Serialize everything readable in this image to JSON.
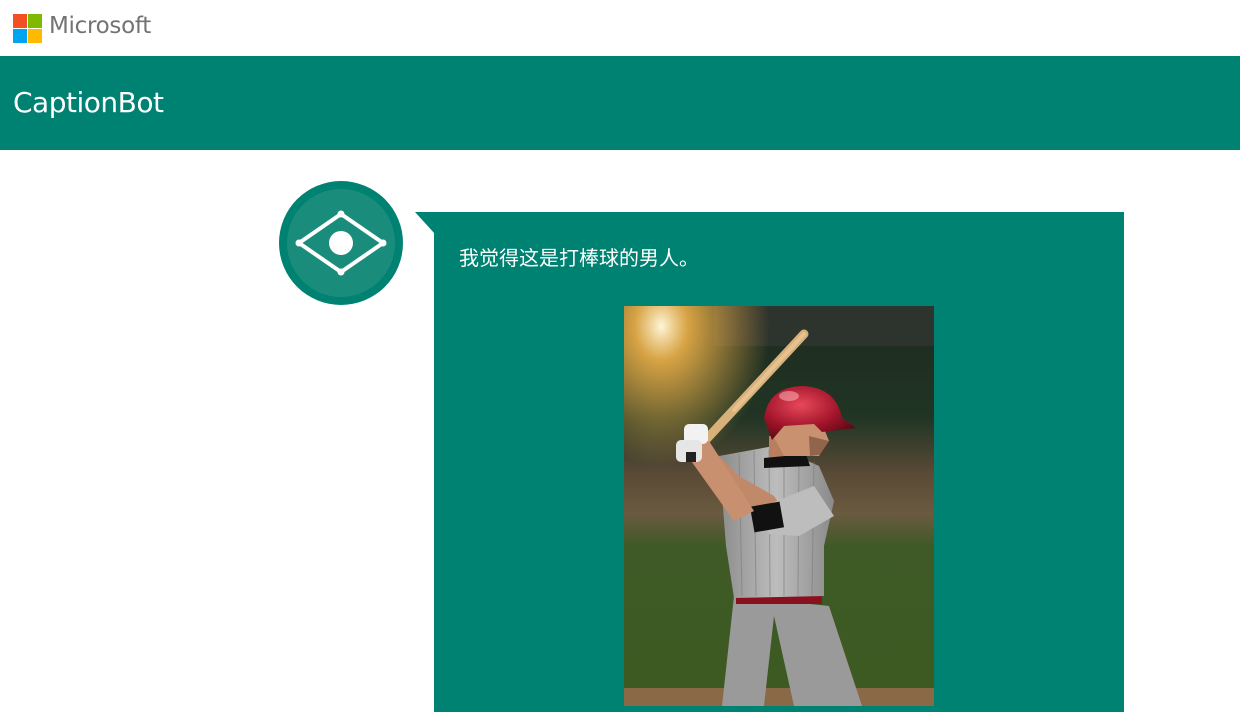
{
  "brand": {
    "name": "Microsoft"
  },
  "header": {
    "title": "CaptionBot"
  },
  "avatar": {
    "icon": "captionbot-eye-icon"
  },
  "message": {
    "caption": "我觉得这是打棒球的男人。",
    "image_icon": "baseball-player-photo"
  },
  "colors": {
    "header_bg": "#008272",
    "bubble_bg": "#008272",
    "ms_red": "#f25022",
    "ms_green": "#7fba00",
    "ms_blue": "#00a4ef",
    "ms_yellow": "#ffb900"
  }
}
